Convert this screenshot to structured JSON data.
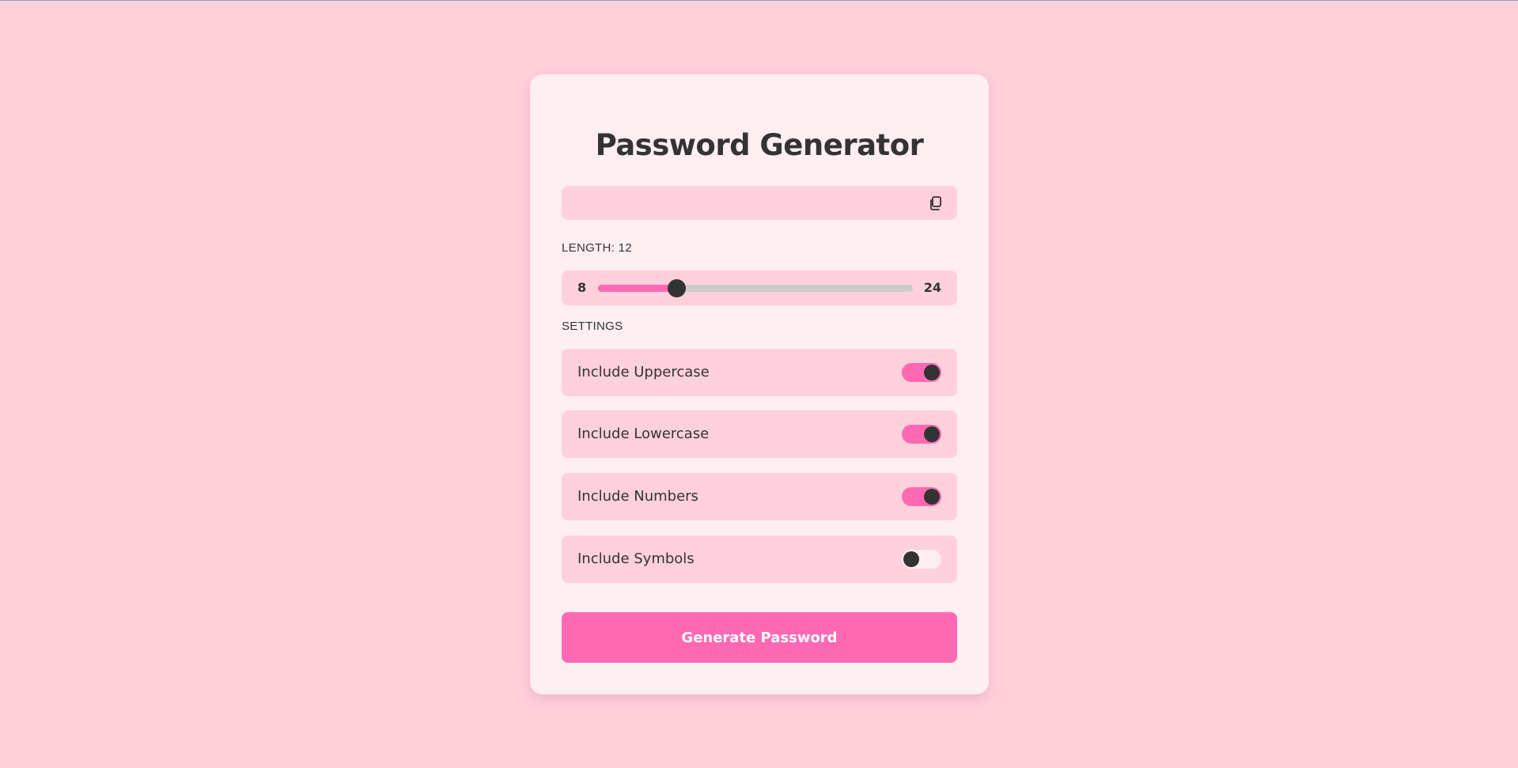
{
  "app": {
    "title": "Password Generator"
  },
  "password": {
    "value": "",
    "copy_icon": "copy-icon"
  },
  "length": {
    "label": "LENGTH: 12",
    "value": 12,
    "min": 8,
    "max": 24,
    "min_label": "8",
    "max_label": "24"
  },
  "settings": {
    "label": "SETTINGS",
    "items": [
      {
        "label": "Include Uppercase",
        "enabled": true
      },
      {
        "label": "Include Lowercase",
        "enabled": true
      },
      {
        "label": "Include Numbers",
        "enabled": true
      },
      {
        "label": "Include Symbols",
        "enabled": false
      }
    ]
  },
  "generate_button": {
    "label": "Generate Password"
  },
  "colors": {
    "background": "#ffcfda",
    "card": "#ffeef2",
    "accent": "#ff69b4",
    "text": "#333333"
  }
}
